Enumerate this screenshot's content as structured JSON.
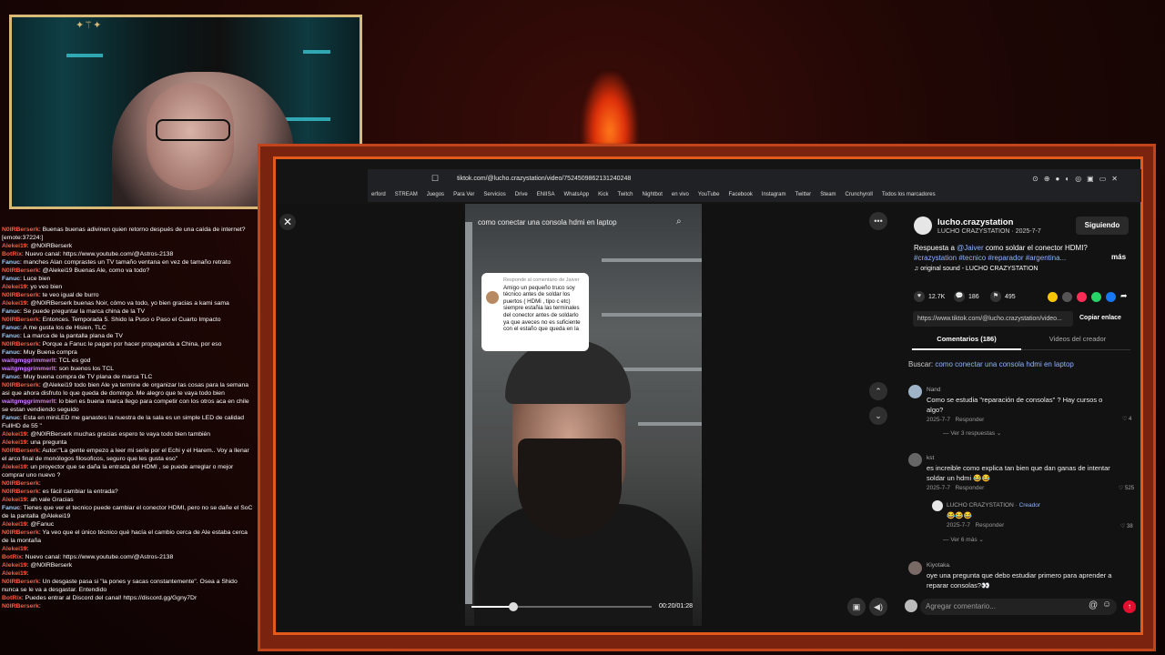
{
  "browser": {
    "url": "tiktok.com/@lucho.crazystation/video/7524509862131240248"
  },
  "bookmarks": [
    "erford",
    "STREAM",
    "Juegos",
    "Para Ver",
    "Servicios",
    "Drive",
    "ENIISA",
    "WhatsApp",
    "Kick",
    "Twitch",
    "Nightbot",
    "en vivo",
    "YouTube",
    "Facebook",
    "Instagram",
    "Twitter",
    "Steam",
    "Crunchyroll",
    "Todos los marcadores"
  ],
  "chat": [
    {
      "user": "N0IRBerserk",
      "color": "#ff5a3c",
      "text": ": Buenas buenas adivinen quien retorno después de una caída de internet? [emote:37224:]"
    },
    {
      "user": "Alekei19",
      "color": "#ff5a3c",
      "text": ": @N0IRBerserk"
    },
    {
      "user": "BotRix",
      "color": "#ff5a3c",
      "text": ": Nuevo canal: https://www.youtube.com/@Astros-2138"
    },
    {
      "user": "Fanuc",
      "color": "#9ad0ff",
      "text": ": manches Alan comprastes un TV tamaño ventana en vez de tamaño retrato"
    },
    {
      "user": "N0IRBerserk",
      "color": "#ff5a3c",
      "text": ": @Alekei19 Buenas Ale, como va todo?"
    },
    {
      "user": "Fanuc",
      "color": "#9ad0ff",
      "text": ": Luce bien"
    },
    {
      "user": "Alekei19",
      "color": "#ff5a3c",
      "text": ": yo veo bien"
    },
    {
      "user": "N0IRBerserk",
      "color": "#ff5a3c",
      "text": ": te veo igual de burro"
    },
    {
      "user": "Alekei19",
      "color": "#ff5a3c",
      "text": ": @N0IRBerserk buenas Noir, cómo va todo, yo bien gracias a kami sama"
    },
    {
      "user": "Fanuc",
      "color": "#9ad0ff",
      "text": ": Se puede preguntar la marca china de la TV"
    },
    {
      "user": "N0IRBerserk",
      "color": "#ff5a3c",
      "text": ": Entonces. Temporada 5. Shido la Puso o Paso el Cuarto Impacto"
    },
    {
      "user": "Fanuc",
      "color": "#9ad0ff",
      "text": ": A me gusta los de Hisien, TLC"
    },
    {
      "user": "Fanuc",
      "color": "#9ad0ff",
      "text": ": La marca de la pantalla plana de TV"
    },
    {
      "user": "N0IRBerserk",
      "color": "#ff5a3c",
      "text": ": Porque a Fanuc le pagan por hacer propaganda a China, por eso"
    },
    {
      "user": "Fanuc",
      "color": "#9ad0ff",
      "text": ": Muy Buena compra"
    },
    {
      "user": "waitgmggrimmerlt",
      "color": "#c87cff",
      "text": ": TCL es god"
    },
    {
      "user": "waitgmggrimmerlt",
      "color": "#c87cff",
      "text": ": son buenos los TCL"
    },
    {
      "user": "Fanuc",
      "color": "#9ad0ff",
      "text": ": Muy buena compra de TV plana de marca TLC"
    },
    {
      "user": "N0IRBerserk",
      "color": "#ff5a3c",
      "text": ": @Alekei19 todo bien Ale ya termine de organizar las cosas para la semana asi que ahora disfruto lo que queda de domingo. Me alegro que te vaya todo bien"
    },
    {
      "user": "waitgmggrimmerlt",
      "color": "#c87cff",
      "text": ": lo bien es buena marca llego para competir con los otros aca en chile se estan vendiendo seguido"
    },
    {
      "user": "Fanuc",
      "color": "#9ad0ff",
      "text": ": Esta en miniLED me ganastes la nuestra de la sala es un simple LED de calidad FullHD de 55 \""
    },
    {
      "user": "Alekei19",
      "color": "#ff5a3c",
      "text": ": @N0IRBerserk muchas gracias espero te vaya todo bien también"
    },
    {
      "user": "Alekei19",
      "color": "#ff5a3c",
      "text": ": una pregunta"
    },
    {
      "user": "N0IRBerserk",
      "color": "#ff5a3c",
      "text": ": Autor:\"La gente empezo a leer mi serie por el Echi y el Harem.. Voy a llenar el arco final de monólogos filosoficos, seguro que les gusta eso\""
    },
    {
      "user": "Alekei19",
      "color": "#ff5a3c",
      "text": ": un proyector que se daña la entrada del HDMI , se puede arreglar o mejor comprar uno nuevo ?"
    },
    {
      "user": "N0IRBerserk",
      "color": "#ff5a3c",
      "text": ":"
    },
    {
      "user": "N0IRBerserk",
      "color": "#ff5a3c",
      "text": ": es fácil cambiar la entrada?"
    },
    {
      "user": "Alekei19",
      "color": "#ff5a3c",
      "text": ": ah vale Gracias"
    },
    {
      "user": "Fanuc",
      "color": "#9ad0ff",
      "text": ": Tienes que ver el tecnico puede cambiar el conector HDMI, pero no se dañe el SoC de la pantalla @Alekei19"
    },
    {
      "user": "Alekei19",
      "color": "#ff5a3c",
      "text": ": @Fanuc"
    },
    {
      "user": "N0IRBerserk",
      "color": "#ff5a3c",
      "text": ": Ya veo que el único técnico qué hacía el cambio cerca de Ale estaba cerca de la montaña"
    },
    {
      "user": "Alekei19",
      "color": "#ff5a3c",
      "text": ":"
    },
    {
      "user": "BotRix",
      "color": "#ff5a3c",
      "text": ": Nuevo canal: https://www.youtube.com/@Astros-2138"
    },
    {
      "user": "Alekei19",
      "color": "#ff5a3c",
      "text": ": @N0IRBerserk"
    },
    {
      "user": "Alekei19",
      "color": "#ff5a3c",
      "text": ":"
    },
    {
      "user": "N0IRBerserk",
      "color": "#ff5a3c",
      "text": ": Un desgaste pasa si \"la pones y sacas constantemente\". Osea a Shido nunca se le va a desgastar. Entendido"
    },
    {
      "user": "BotRix",
      "color": "#ff5a3c",
      "text": ": Puedes entrar al Discord del canal! https://discord.gg/Ggny7Dr"
    },
    {
      "user": "N0IRBerserk",
      "color": "#ff5a3c",
      "text": ":"
    }
  ],
  "video": {
    "title": "como conectar una consola hdmi en laptop",
    "reply_ref": "Responde al comentario de Jaiver",
    "reply_text": "Amigo un pequeño truco soy técnico antes de soldar los puertos ( HDMi , tipo c etc) siempre estañia las terminales del conector antes de soldarlo ya que aveces no es suficiente con el estaño que queda en la",
    "time": "00:20/01:28",
    "progress": 0.23
  },
  "author": {
    "handle": "lucho.crazystation",
    "name_date": "LUCHO CRAZYSTATION · 2025-7-7",
    "follow_label": "Siguiendo",
    "desc_prefix": "Respuesta a ",
    "mention": "@Jaiver",
    "desc_rest": " como soldar el conector HDMI?",
    "hashtags": "#crazystation #tecnico #reparador #argentina...",
    "more": "más",
    "sound": "original sound - LUCHO CRAZYSTATION"
  },
  "stats": {
    "likes": "12.7K",
    "comments": "186",
    "saves": "495"
  },
  "share": {
    "link": "https://www.tiktok.com/@lucho.crazystation/video...",
    "copy_label": "Copiar enlace",
    "colors": [
      "#f7c600",
      "#555555",
      "#ff2d55",
      "#25d366",
      "#1877f2"
    ]
  },
  "tabs": {
    "comments": "Comentarios (186)",
    "creator_videos": "Videos del creador"
  },
  "search": {
    "prefix": "Buscar: ",
    "query": "como conectar una consola hdmi en laptop"
  },
  "comments": [
    {
      "user": "Nand",
      "text": "Como se estudia \"reparación de consolas\" ? Hay cursos o algo?",
      "date": "2025-7-7",
      "reply": "Responder",
      "likes": "4",
      "more": "Ver 3 respuestas"
    },
    {
      "user": "kst",
      "text": "es increible como explica tan bien que dan ganas de intentar soldar un hdmi 😂😂",
      "date": "2025-7-7",
      "reply": "Responder",
      "likes": "525"
    },
    {
      "user": "LUCHO CRAZYSTATION",
      "badge": "Creador",
      "text": "😂😂😂",
      "date": "2025-7-7",
      "reply": "Responder",
      "likes": "38",
      "more": "Ver 6 más"
    },
    {
      "user": "Kiyotaka.",
      "text": "oye una pregunta que debo estudiar primero para aprender a reparar consolas?👀"
    }
  ],
  "input": {
    "placeholder": "Agregar comentario..."
  }
}
